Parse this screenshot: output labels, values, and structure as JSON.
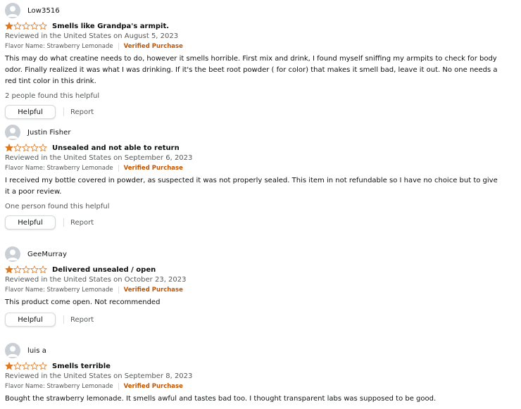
{
  "colors": {
    "star_fill": "#de7921",
    "star_empty_stroke": "#de7921",
    "verified": "#c45500",
    "secondary_text": "#565959"
  },
  "reviews": [
    {
      "author": "Low3516",
      "rating": 1,
      "rating_max": 5,
      "title": "Smells like Grandpa's armpit.",
      "reviewed": "Reviewed in the United States on August 5, 2023",
      "flavor": "Flavor Name: Strawberry Lemonade",
      "verified": "Verified Purchase",
      "body": "This may do what creatine needs to do, however it smells horrible. First mix and drink, I found myself sniffing my armpits to check for body odor. Finally realized it was what I was drinking. If it's the beet root powder ( for color) that makes it smell bad, leave it out. No one needs a red tint color in this drink.",
      "helpful_count": "2 people found this helpful",
      "helpful_label": "Helpful",
      "report_label": "Report"
    },
    {
      "author": "Justin Fisher",
      "rating": 1,
      "rating_max": 5,
      "title": "Unsealed and not able to return",
      "reviewed": "Reviewed in the United States on September 6, 2023",
      "flavor": "Flavor Name: Strawberry Lemonade",
      "verified": "Verified Purchase",
      "body": "I received my bottle covered in powder, as suspected it was not properly sealed. This item in not refundable so I have no choice but to give it a poor review.",
      "helpful_count": "One person found this helpful",
      "helpful_label": "Helpful",
      "report_label": "Report"
    },
    {
      "author": "GeeMurray",
      "rating": 1,
      "rating_max": 5,
      "title": "Delivered unsealed / open",
      "reviewed": "Reviewed in the United States on October 23, 2023",
      "flavor": "Flavor Name: Strawberry Lemonade",
      "verified": "Verified Purchase",
      "body": "This product come open. Not recommended",
      "helpful_count": "",
      "helpful_label": "Helpful",
      "report_label": "Report"
    },
    {
      "author": "luis a",
      "rating": 1,
      "rating_max": 5,
      "title": "Smells terrible",
      "reviewed": "Reviewed in the United States on September 8, 2023",
      "flavor": "Flavor Name: Strawberry Lemonade",
      "verified": "Verified Purchase",
      "body": "Bought the strawberry lemonade. It smells awful and tastes bad too. I thought transparent labs was supposed to be good.",
      "helpful_count": "",
      "helpful_label": "",
      "report_label": ""
    }
  ]
}
